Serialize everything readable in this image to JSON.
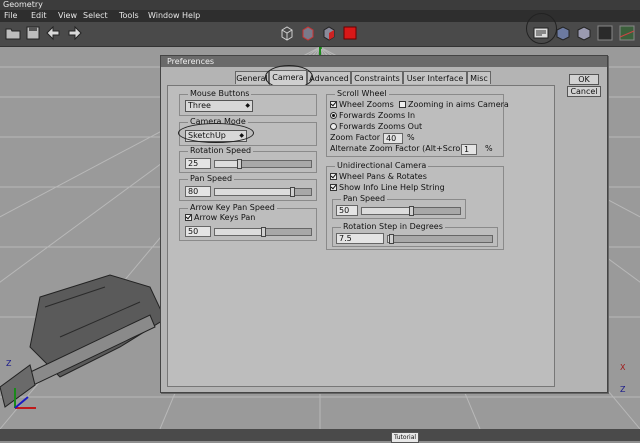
{
  "window": {
    "title": "Geometry"
  },
  "menu": [
    "File",
    "Edit",
    "View",
    "Select",
    "Tools",
    "Window",
    "Help"
  ],
  "toolbar": {
    "left_icons": [
      "open-icon",
      "save-icon",
      "back-arrow-icon",
      "forward-arrow-icon"
    ],
    "center_icons": [
      "wireframe-cube-icon",
      "shaded-cube-icon",
      "red-cube-icon",
      "solid-red-cube-icon"
    ],
    "right_icons": [
      "preferences-icon",
      "shaded-box-icon",
      "box-icon",
      "grid-icon",
      "ground-icon"
    ]
  },
  "dialog": {
    "title": "Preferences",
    "tabs": [
      "General",
      "Camera",
      "Advanced",
      "Constraints",
      "User Interface",
      "Misc"
    ],
    "active_tab": "Camera",
    "ok_label": "OK",
    "cancel_label": "Cancel",
    "mouse_buttons": {
      "label": "Mouse Buttons",
      "value": "Three"
    },
    "camera_mode": {
      "label": "Camera Mode",
      "value": "SketchUp"
    },
    "rotation_speed": {
      "label": "Rotation Speed",
      "value": "25",
      "fraction": 0.25
    },
    "pan_speed": {
      "label": "Pan Speed",
      "value": "80",
      "fraction": 0.8
    },
    "arrow_key": {
      "label": "Arrow Key Pan Speed",
      "checkbox_label": "Arrow Keys Pan",
      "checked": true,
      "value": "50",
      "fraction": 0.5
    },
    "scroll_wheel": {
      "label": "Scroll Wheel",
      "wheel_zooms": "Wheel Zooms",
      "zooming_in_aims": "Zooming in aims Camera",
      "forwards_in": "Forwards Zooms In",
      "forwards_out": "Forwards Zooms Out",
      "zoom_factor_label": "Zoom Factor",
      "zoom_factor_value": "40",
      "alt_zoom_label": "Alternate Zoom Factor (Alt+Scroll)",
      "alt_zoom_value": "1",
      "percent": "%"
    },
    "unidirectional": {
      "label": "Unidirectional Camera",
      "wheel_pans": "Wheel Pans & Rotates",
      "show_info": "Show Info Line Help String",
      "pan_speed_label": "Pan Speed",
      "pan_speed_value": "50",
      "pan_speed_fraction": 0.5,
      "rotation_step_label": "Rotation Step in Degrees",
      "rotation_step_value": "7.5",
      "rotation_step_fraction": 0.03
    }
  },
  "viewport": {
    "axis_labels": [
      "Y",
      "Z",
      "X",
      "Z"
    ]
  },
  "status": {
    "tutorial_label": "Tutorial"
  }
}
